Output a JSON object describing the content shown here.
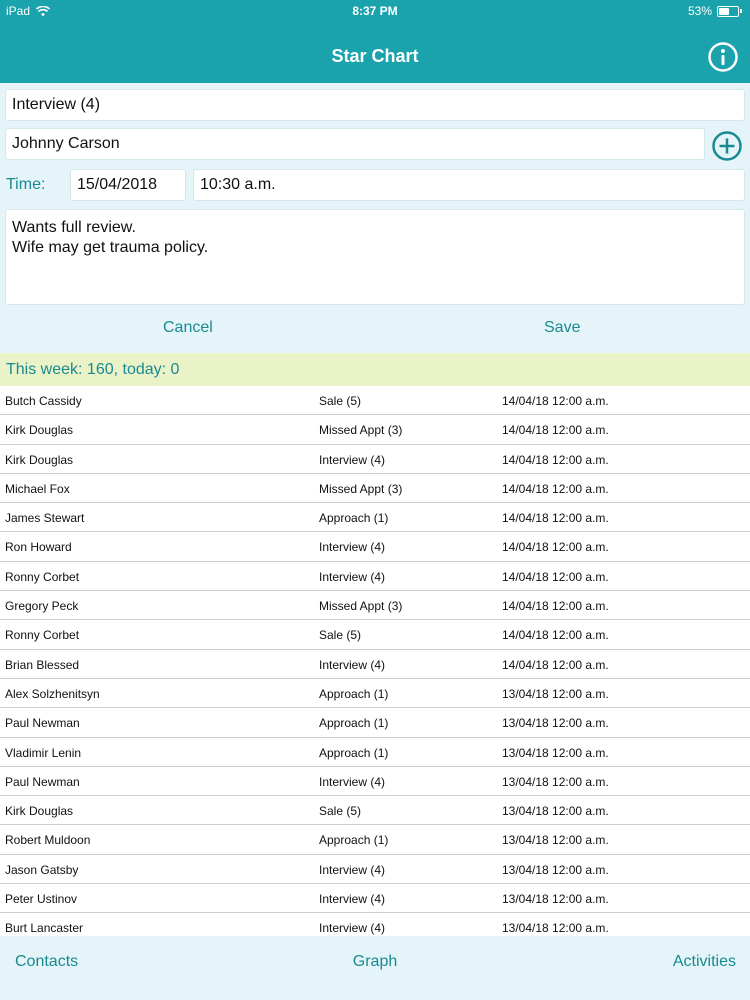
{
  "status_bar": {
    "carrier": "iPad",
    "time": "8:37 PM",
    "battery": "53%",
    "battery_level": 0.53
  },
  "header": {
    "title": "Star Chart"
  },
  "form": {
    "activity_type": "Interview (4)",
    "contact_name": "Johnny Carson",
    "time_label": "Time:",
    "date": "15/04/2018",
    "time": "10:30 a.m.",
    "notes_line1": "Wants full review.",
    "notes_line2": "Wife may get trauma policy.",
    "cancel_label": "Cancel",
    "save_label": "Save"
  },
  "summary": "This week: 160, today: 0",
  "rows": [
    {
      "name": "Butch Cassidy",
      "activity": "Sale (5)",
      "date": "14/04/18 12:00 a.m."
    },
    {
      "name": "Kirk Douglas",
      "activity": "Missed Appt (3)",
      "date": "14/04/18 12:00 a.m."
    },
    {
      "name": "Kirk Douglas",
      "activity": "Interview (4)",
      "date": "14/04/18 12:00 a.m."
    },
    {
      "name": "Michael Fox",
      "activity": "Missed Appt (3)",
      "date": "14/04/18 12:00 a.m."
    },
    {
      "name": "James Stewart",
      "activity": "Approach (1)",
      "date": "14/04/18 12:00 a.m."
    },
    {
      "name": "Ron Howard",
      "activity": "Interview (4)",
      "date": "14/04/18 12:00 a.m."
    },
    {
      "name": "Ronny Corbet",
      "activity": "Interview (4)",
      "date": "14/04/18 12:00 a.m."
    },
    {
      "name": "Gregory Peck",
      "activity": "Missed Appt (3)",
      "date": "14/04/18 12:00 a.m."
    },
    {
      "name": "Ronny Corbet",
      "activity": "Sale (5)",
      "date": "14/04/18 12:00 a.m."
    },
    {
      "name": "Brian Blessed",
      "activity": "Interview (4)",
      "date": "14/04/18 12:00 a.m."
    },
    {
      "name": "Alex Solzhenitsyn",
      "activity": "Approach (1)",
      "date": "13/04/18 12:00 a.m."
    },
    {
      "name": "Paul Newman",
      "activity": "Approach (1)",
      "date": "13/04/18 12:00 a.m."
    },
    {
      "name": "Vladimir Lenin",
      "activity": "Approach (1)",
      "date": "13/04/18 12:00 a.m."
    },
    {
      "name": "Paul Newman",
      "activity": "Interview (4)",
      "date": "13/04/18 12:00 a.m."
    },
    {
      "name": "Kirk Douglas",
      "activity": "Sale (5)",
      "date": "13/04/18 12:00 a.m."
    },
    {
      "name": "Robert Muldoon",
      "activity": "Approach (1)",
      "date": "13/04/18 12:00 a.m."
    },
    {
      "name": "Jason Gatsby",
      "activity": "Interview (4)",
      "date": "13/04/18 12:00 a.m."
    },
    {
      "name": "Peter Ustinov",
      "activity": "Interview (4)",
      "date": "13/04/18 12:00 a.m."
    },
    {
      "name": "Burt Lancaster",
      "activity": "Interview (4)",
      "date": "13/04/18 12:00 a.m."
    }
  ],
  "tabs": {
    "contacts": "Contacts",
    "graph": "Graph",
    "activities": "Activities"
  },
  "icons": {
    "info": "info-icon",
    "add": "add-circle-icon",
    "wifi": "wifi-icon",
    "battery": "battery-icon"
  },
  "colors": {
    "header": "#1aa3ac",
    "accent": "#1a8a91",
    "form_bg": "#e4f4f8",
    "summary_bg": "#eaf2c8"
  }
}
